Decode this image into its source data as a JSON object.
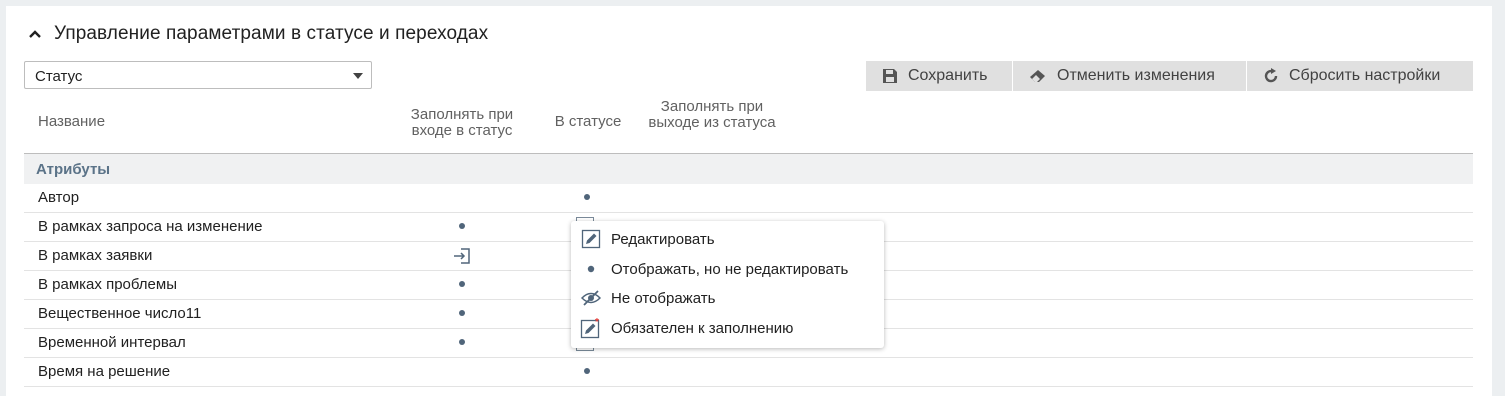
{
  "section": {
    "title": "Управление параметрами в статусе и переходах"
  },
  "status_select": {
    "value": "Статус"
  },
  "toolbar": {
    "save_label": "Сохранить",
    "cancel_label": "Отменить изменения",
    "reset_label": "Сбросить настройки"
  },
  "table": {
    "headers": {
      "name": "Название",
      "entry": "Заполнять при входе в статус",
      "in_status": "В статусе",
      "exit": "Заполнять при выходе из статуса"
    },
    "group": "Атрибуты",
    "rows": [
      {
        "name": "Автор",
        "entry": "",
        "in_status": "display-only"
      },
      {
        "name": "В рамках запроса на изменение",
        "entry": "display-only",
        "in_status": "obscured"
      },
      {
        "name": "В рамках заявки",
        "entry": "fill-on-entry",
        "in_status": "obscured"
      },
      {
        "name": "В рамках проблемы",
        "entry": "display-only",
        "in_status": "obscured"
      },
      {
        "name": "Вещественное число11",
        "entry": "display-only",
        "in_status": "obscured"
      },
      {
        "name": "Временной интервал",
        "entry": "display-only",
        "in_status": "obscured"
      },
      {
        "name": "Время на решение",
        "entry": "",
        "in_status": "display-only"
      }
    ]
  },
  "popup_menu": {
    "items": [
      {
        "label": "Редактировать",
        "icon": "pencil-icon"
      },
      {
        "label": "Отображать, но не редактировать",
        "icon": "dot-icon"
      },
      {
        "label": "Не отображать",
        "icon": "eye-off-icon"
      },
      {
        "label": "Обязателен к заполнению",
        "icon": "pencil-required-icon"
      }
    ]
  },
  "colors": {
    "group_text": "#5b7388",
    "dot": "#50657a",
    "button_bg": "#e0e0e0",
    "required_star": "#e53935"
  }
}
